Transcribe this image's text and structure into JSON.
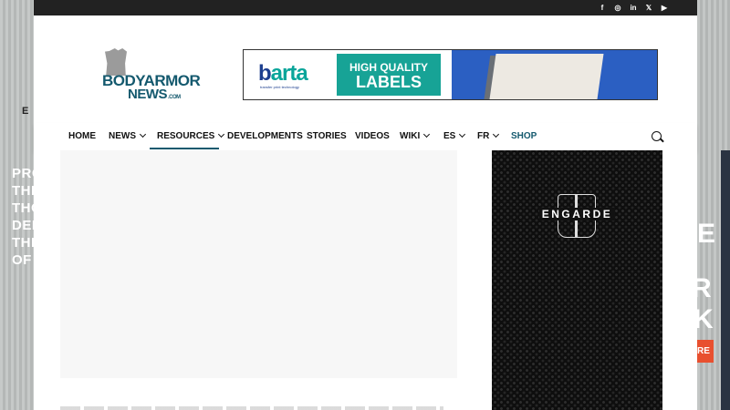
{
  "background": {
    "left_top_text": "E",
    "left_text_lines": [
      "PRO",
      "THE",
      "THO",
      "DEF",
      "THE",
      "OF"
    ],
    "right_glyphs": [
      "E",
      "R",
      "K"
    ],
    "right_badge": "RE"
  },
  "topbar": {
    "social": [
      {
        "name": "facebook",
        "glyph": "f"
      },
      {
        "name": "instagram",
        "glyph": "◎"
      },
      {
        "name": "linkedin",
        "glyph": "in"
      },
      {
        "name": "x",
        "glyph": "𝕏"
      },
      {
        "name": "youtube",
        "glyph": "▶"
      }
    ]
  },
  "header": {
    "logo_line1": "BODYARMOR",
    "logo_line2": "NEWS",
    "logo_suffix": ".COM",
    "ad": {
      "brand_b": "b",
      "brand_rest": "arta",
      "tagline": "transfer print technology",
      "label_line1": "HIGH QUALITY",
      "label_line2": "LABELS"
    }
  },
  "nav": {
    "items": [
      {
        "label": "HOME",
        "dropdown": false
      },
      {
        "label": "NEWS",
        "dropdown": true
      },
      {
        "label": "RESOURCES",
        "dropdown": true,
        "active": true
      },
      {
        "label": "DEVELOPMENTS",
        "dropdown": false
      },
      {
        "label": "STORIES",
        "dropdown": false
      },
      {
        "label": "VIDEOS",
        "dropdown": false
      },
      {
        "label": "WIKI",
        "dropdown": true
      },
      {
        "label": "ES",
        "dropdown": true
      },
      {
        "label": "FR",
        "dropdown": true
      },
      {
        "label": "SHOP",
        "dropdown": false
      }
    ]
  },
  "sidebar_ad": {
    "brand": "ENGARDE"
  },
  "colors": {
    "brand": "#14596e",
    "topbar": "#222222",
    "ad_teal": "#17a396"
  }
}
